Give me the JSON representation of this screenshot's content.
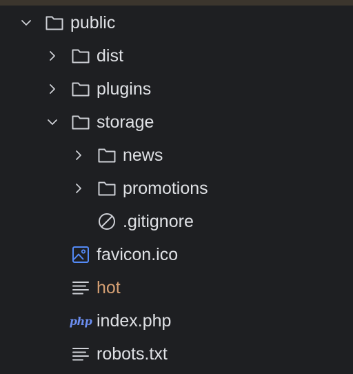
{
  "tree": {
    "public": {
      "label": "public",
      "icon": "folder-icon",
      "expanded": true
    },
    "dist": {
      "label": "dist",
      "icon": "folder-icon",
      "expanded": false
    },
    "plugins": {
      "label": "plugins",
      "icon": "folder-icon",
      "expanded": false
    },
    "storage": {
      "label": "storage",
      "icon": "folder-icon",
      "expanded": true
    },
    "news": {
      "label": "news",
      "icon": "folder-icon",
      "expanded": false
    },
    "promotions": {
      "label": "promotions",
      "icon": "folder-icon",
      "expanded": false
    },
    "gitignore": {
      "label": ".gitignore",
      "icon": "ignored-file-icon"
    },
    "favicon": {
      "label": "favicon.ico",
      "icon": "image-file-icon"
    },
    "hot": {
      "label": "hot",
      "icon": "text-file-icon",
      "status_color": "#d6a074"
    },
    "index": {
      "label": "index.php",
      "icon": "php-file-icon",
      "badge": "php"
    },
    "robots": {
      "label": "robots.txt",
      "icon": "text-file-icon"
    }
  },
  "colors": {
    "background": "#1e1f22",
    "text": "#dfe1e5",
    "modified_text": "#d6a074",
    "icon_stroke": "#ced0d6",
    "image_icon": "#548af7",
    "php_icon": "#6b8ef0"
  }
}
